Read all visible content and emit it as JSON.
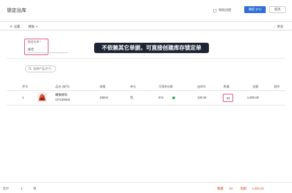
{
  "header": {
    "title": "锁定出库",
    "continue_create_label": "继续创建",
    "confirm_label": "确定 (F1)",
    "cancel_label": "取消"
  },
  "toolbar": {
    "settings_label": "设置",
    "template_label": "模板",
    "more_label": "更多"
  },
  "form": {
    "warehouse_label": "锁定仓库 *",
    "warehouse_value": "总仓"
  },
  "banner_text": "不依赖其它单据，可直接创建库存锁定单",
  "product_button_label": "选择产品 (F7)",
  "table": {
    "columns": [
      "序号",
      "品名 (规号)",
      "规格",
      "单位",
      "可用库存数",
      "出库价",
      "数量",
      "金额",
      "操作"
    ],
    "rows": [
      {
        "index": "1",
        "name": "蠔爽蚝料",
        "code": "CFX30003",
        "spec": "280ml",
        "unit": "包",
        "available": "974",
        "price": "100.00",
        "quantity": "10",
        "amount": "1,000.00"
      }
    ]
  },
  "footer": {
    "total_label": "合计",
    "total_count": "1",
    "unit_label": "项",
    "qty_label": "数量:",
    "qty_value": "10",
    "amount_label": "金额:",
    "amount_value": "1,000.00"
  },
  "colors": {
    "accent": "#2f6ed8",
    "highlight": "#e0567a",
    "footer_total": "#e0401f",
    "status_ok": "#3ba55c"
  }
}
